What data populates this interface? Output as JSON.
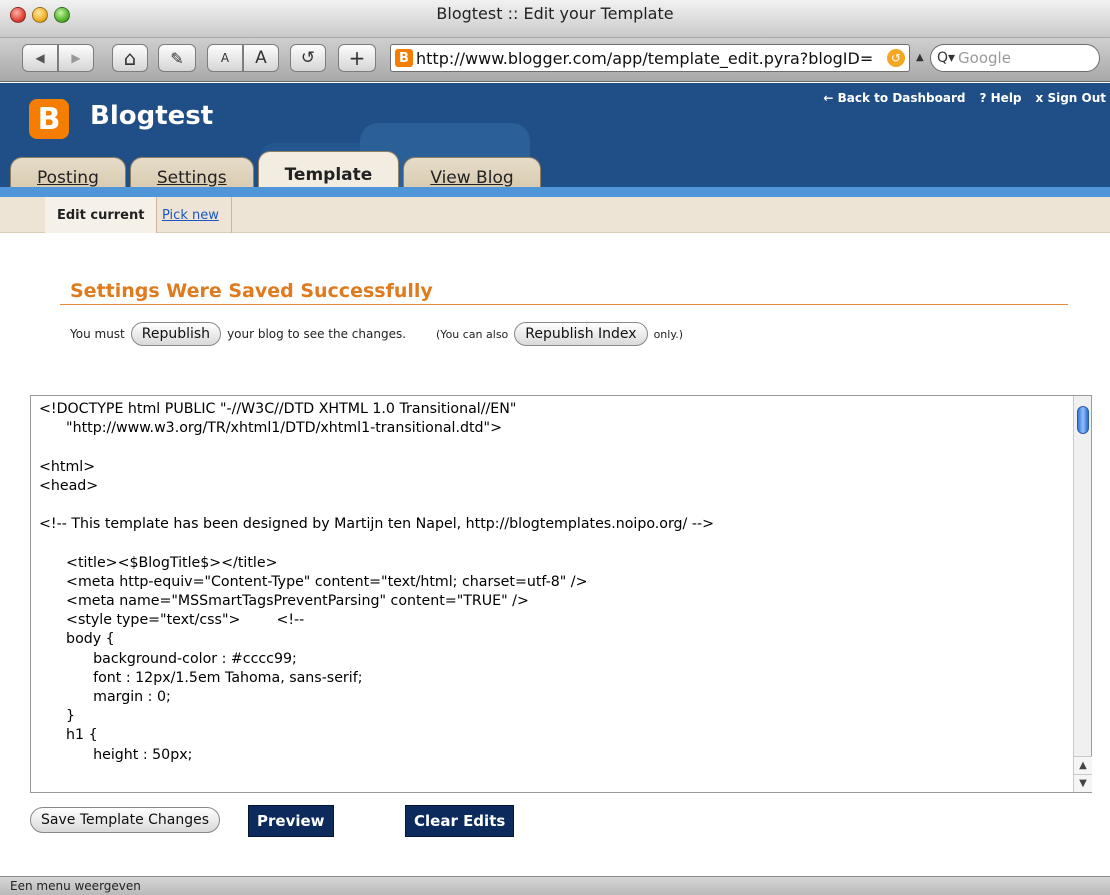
{
  "window": {
    "title": "Blogtest :: Edit your Template"
  },
  "toolbar": {
    "back_glyph": "◀",
    "forward_glyph": "▶",
    "home_glyph": "⌂",
    "edit_glyph": "✎",
    "text_small": "A",
    "text_large": "A",
    "reload_glyph": "↺",
    "add_glyph": "+",
    "url": "http://www.blogger.com/app/template_edit.pyra?blogID=",
    "search_placeholder": "Google",
    "favicon_letter": "B"
  },
  "header": {
    "logo_letter": "B",
    "blog_title": "Blogtest",
    "links": {
      "dashboard": "← Back to Dashboard",
      "help": "? Help",
      "signout": "x Sign Out"
    },
    "tabs": [
      {
        "label": "Posting"
      },
      {
        "label": "Settings"
      },
      {
        "label": "Template"
      },
      {
        "label": "View Blog"
      }
    ]
  },
  "subnav": {
    "current": "Edit current",
    "pick_new": "Pick new"
  },
  "message": {
    "title": "Settings Were Saved Successfully",
    "prefix": "You must",
    "republish_button": "Republish",
    "middle": "your blog to see the changes.",
    "also": "(You can also",
    "republish_index_button": "Republish Index",
    "suffix": "only.)"
  },
  "editor": {
    "code": "<!DOCTYPE html PUBLIC \"-//W3C//DTD XHTML 1.0 Transitional//EN\"\n      \"http://www.w3.org/TR/xhtml1/DTD/xhtml1-transitional.dtd\">\n\n<html>\n<head>\n\n<!-- This template has been designed by Martijn ten Napel, http://blogtemplates.noipo.org/ -->\n\n      <title><$BlogTitle$></title>\n      <meta http-equiv=\"Content-Type\" content=\"text/html; charset=utf-8\" />\n      <meta name=\"MSSmartTagsPreventParsing\" content=\"TRUE\" />\n      <style type=\"text/css\">        <!--\n      body {\n            background-color : #cccc99;\n            font : 12px/1.5em Tahoma, sans-serif;\n            margin : 0;\n      }\n      h1 {\n            height : 50px;"
  },
  "buttons": {
    "save": "Save Template Changes",
    "preview": "Preview",
    "clear": "Clear Edits"
  },
  "status": {
    "text": "Een menu weergeven"
  },
  "colors": {
    "header_bg": "#1f4f86",
    "accent_orange": "#e07a1e",
    "dark_button": "#0d2a5c"
  }
}
